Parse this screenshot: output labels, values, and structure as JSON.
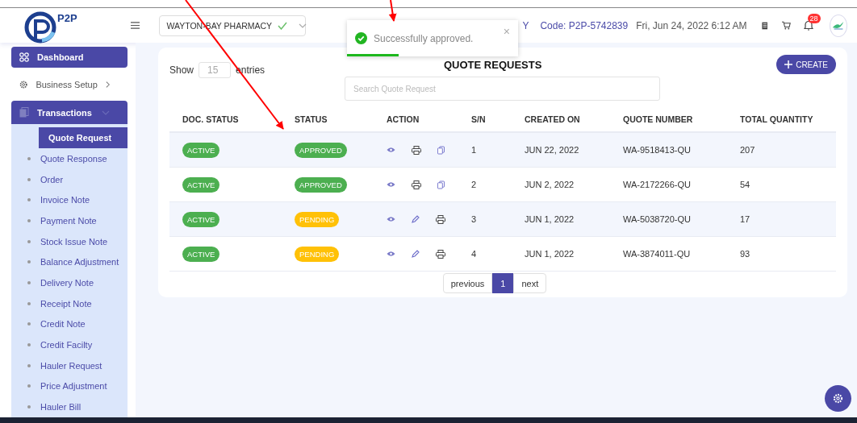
{
  "header": {
    "logo_text": "P2P",
    "company_select": {
      "value": "WAYTON-BAY PHARMACY"
    },
    "partial_text": "Y",
    "code": "Code: P2P-5742839",
    "datetime": "Fri, Jun 24, 2022 6:12 AM",
    "notification_count": "28"
  },
  "toast": {
    "message": "Successfully approved.",
    "close": "×",
    "level": 0.3
  },
  "sidebar": {
    "items": [
      {
        "label": "Dashboard",
        "selected": true
      },
      {
        "label": "Business Setup",
        "selected": false,
        "expanded": false
      },
      {
        "label": "Transactions",
        "selected": true,
        "expanded": true,
        "children": [
          {
            "label": "Quote Request",
            "selected": true
          },
          {
            "label": "Quote Response",
            "selected": false
          },
          {
            "label": "Order",
            "selected": false
          },
          {
            "label": "Invoice Note",
            "selected": false
          },
          {
            "label": "Payment Note",
            "selected": false
          },
          {
            "label": "Stock Issue Note",
            "selected": false
          },
          {
            "label": "Balance Adjustment",
            "selected": false
          },
          {
            "label": "Delivery Note",
            "selected": false
          },
          {
            "label": "Receipt Note",
            "selected": false
          },
          {
            "label": "Credit Note",
            "selected": false
          },
          {
            "label": "Credit Facilty",
            "selected": false
          },
          {
            "label": "Hauler Request",
            "selected": false
          },
          {
            "label": "Price Adjustment",
            "selected": false
          },
          {
            "label": "Hauler Bill",
            "selected": false
          }
        ]
      }
    ]
  },
  "card": {
    "title": "QUOTE REQUESTS",
    "show_label": "Show",
    "entries_value": "15",
    "entries_label": "entries",
    "create_button": "CREATE",
    "search": {
      "placeholder": "Search Quote Request"
    },
    "table": {
      "columns": [
        "DOC. STATUS",
        "STATUS",
        "ACTION",
        "S/N",
        "CREATED ON",
        "QUOTE NUMBER",
        "TOTAL QUANTITY"
      ],
      "rows": [
        {
          "doc_status": "ACTIVE",
          "status": {
            "label": "APPROVED",
            "color": "#4caf50"
          },
          "actions": [
            {
              "kind": "view"
            },
            {
              "kind": "print"
            },
            {
              "kind": "copy"
            }
          ],
          "sn": "1",
          "created_on": "JUN 22, 2022",
          "quote_number": "WA-9518413-QU",
          "total_quantity": "207"
        },
        {
          "doc_status": "ACTIVE",
          "status": {
            "label": "APPROVED",
            "color": "#4caf50"
          },
          "actions": [
            {
              "kind": "view"
            },
            {
              "kind": "print"
            },
            {
              "kind": "copy"
            }
          ],
          "sn": "2",
          "created_on": "JUN 2, 2022",
          "quote_number": "WA-2172266-QU",
          "total_quantity": "54"
        },
        {
          "doc_status": "ACTIVE",
          "status": {
            "label": "PENDING",
            "color": "#ffc107"
          },
          "actions": [
            {
              "kind": "view"
            },
            {
              "kind": "edit"
            },
            {
              "kind": "print"
            }
          ],
          "sn": "3",
          "created_on": "JUN 1, 2022",
          "quote_number": "WA-5038720-QU",
          "total_quantity": "17"
        },
        {
          "doc_status": "ACTIVE",
          "status": {
            "label": "PENDING",
            "color": "#ffc107"
          },
          "actions": [
            {
              "kind": "view"
            },
            {
              "kind": "edit"
            },
            {
              "kind": "print"
            }
          ],
          "sn": "4",
          "created_on": "JUN 1, 2022",
          "quote_number": "WA-3874011-QU",
          "total_quantity": "93"
        }
      ]
    },
    "pagination": {
      "previous": "previous",
      "pages": [
        {
          "label": "1",
          "selected": true
        }
      ],
      "next": "next"
    }
  }
}
